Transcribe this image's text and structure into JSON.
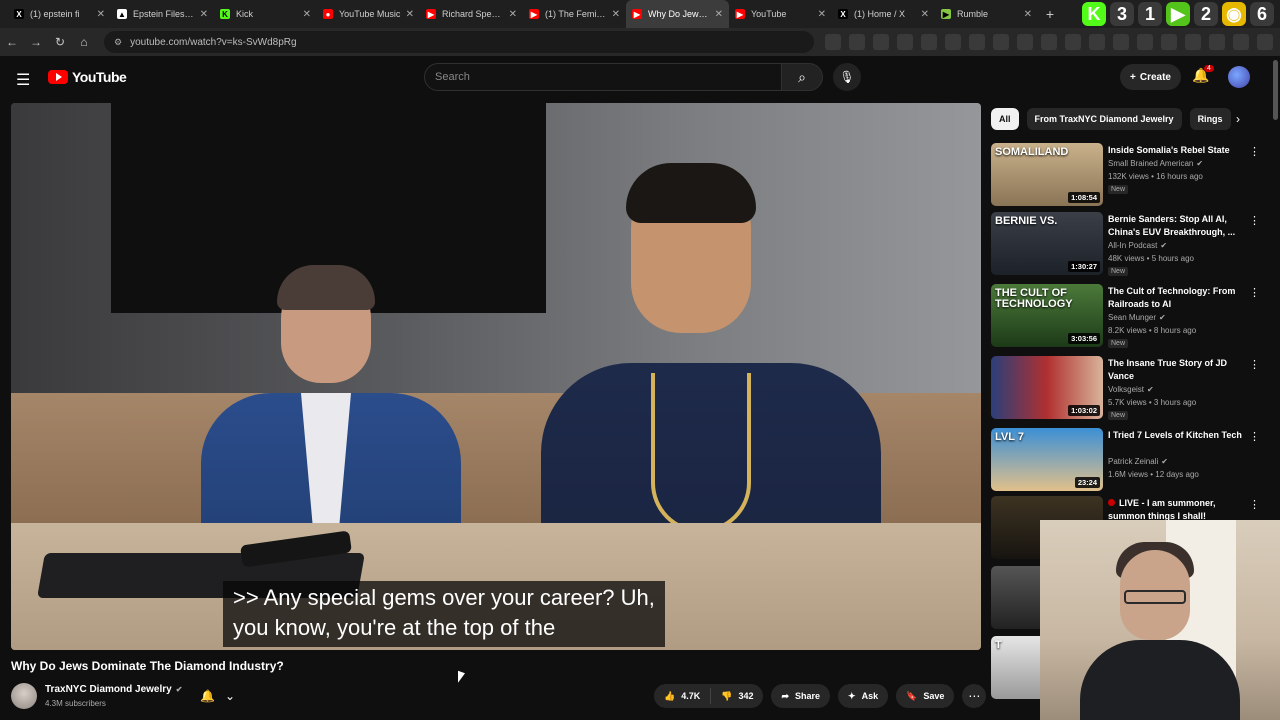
{
  "browser": {
    "tabs": [
      {
        "title": "(1) epstein fi",
        "fav_color": "#000000",
        "fav_glyph": "X"
      },
      {
        "title": "Epstein Files Bro",
        "fav_color": "#ffffff",
        "fav_glyph": "▲"
      },
      {
        "title": "Kick",
        "fav_color": "#53fc18",
        "fav_glyph": "K"
      },
      {
        "title": "YouTube Music",
        "fav_color": "#ff0000",
        "fav_glyph": "●"
      },
      {
        "title": "Richard Spencer",
        "fav_color": "#ff0000",
        "fav_glyph": "▶"
      },
      {
        "title": "(1) The Feminist",
        "fav_color": "#ff0000",
        "fav_glyph": "▶"
      },
      {
        "title": "Why Do Jews D",
        "fav_color": "#ff0000",
        "fav_glyph": "▶",
        "active": true
      },
      {
        "title": "YouTube",
        "fav_color": "#ff0000",
        "fav_glyph": "▶"
      },
      {
        "title": "(1) Home / X",
        "fav_color": "#000000",
        "fav_glyph": "X"
      },
      {
        "title": "Rumble",
        "fav_color": "#85c742",
        "fav_glyph": "▶"
      }
    ],
    "new_tab_glyph": "+",
    "ext_badges": [
      {
        "label": "K",
        "color": "#53fc18"
      },
      {
        "label": "3",
        "color": "#3a3a3a"
      },
      {
        "label": "1",
        "color": "#3a3a3a"
      },
      {
        "label": "▶",
        "color": "#53c41a"
      },
      {
        "label": "2",
        "color": "#3a3a3a"
      },
      {
        "label": "◉",
        "color": "#e6b800"
      },
      {
        "label": "6",
        "color": "#3a3a3a"
      }
    ],
    "url": "youtube.com/watch?v=ks-SvWd8pRg"
  },
  "youtube": {
    "logo_text": "YouTube",
    "search_placeholder": "Search",
    "create_label": "Create",
    "notification_count": "4"
  },
  "video": {
    "caption_line1": ">> Any special gems over your career? Uh,",
    "caption_line2": "you know, you're at the top of the",
    "title": "Why Do Jews Dominate The Diamond Industry?",
    "channel": "TraxNYC Diamond Jewelry",
    "subscribers": "4.3M subscribers",
    "likes": "4.7K",
    "dislikes": "342",
    "share_label": "Share",
    "ask_label": "Ask",
    "save_label": "Save"
  },
  "sidebar": {
    "chips": [
      "All",
      "From TraxNYC Diamond Jewelry",
      "Rings"
    ],
    "recommendations": [
      {
        "title": "Inside Somalia's Rebel State",
        "channel": "Small Brained American",
        "meta": "132K views • 16 hours ago",
        "badge": "New",
        "duration": "1:08:54",
        "thumb_text": "SOMALILAND",
        "thumb_bg": "linear-gradient(180deg,#c9b18a,#8a7456)"
      },
      {
        "title": "Bernie Sanders: Stop All AI, China's EUV Breakthrough, ...",
        "channel": "All-In Podcast",
        "meta": "48K views • 5 hours ago",
        "badge": "New",
        "duration": "1:30:27",
        "thumb_text": "BERNIE VS.",
        "thumb_bg": "linear-gradient(180deg,#3a3f48,#1d2128)"
      },
      {
        "title": "The Cult of Technology: From Railroads to AI",
        "channel": "Sean Munger",
        "meta": "8.2K views • 8 hours ago",
        "badge": "New",
        "duration": "3:03:56",
        "thumb_text": "THE CULT OF TECHNOLOGY",
        "thumb_bg": "linear-gradient(180deg,#4b7a3a,#1d3a18)"
      },
      {
        "title": "The Insane True Story of JD Vance",
        "channel": "Volksgeist",
        "meta": "5.7K views • 3 hours ago",
        "badge": "New",
        "duration": "1:03:02",
        "thumb_text": "",
        "thumb_bg": "linear-gradient(90deg,#2b3f7a 0%,#b03030 50%,#d8b49a 100%)"
      },
      {
        "title": "I Tried 7 Levels of Kitchen Tech",
        "channel": "Patrick Zeinali",
        "meta": "1.6M views • 12 days ago",
        "badge": "",
        "duration": "23:24",
        "thumb_text": "LVL 7",
        "thumb_bg": "linear-gradient(180deg,#3b8fd6,#e2c08a)"
      },
      {
        "title": "LIVE - I am summoner, summon things I shall!",
        "channel": "",
        "meta": "",
        "badge": "",
        "duration": "",
        "thumb_text": "",
        "thumb_bg": "linear-gradient(180deg,#3d3322,#171410)",
        "live": true
      },
      {
        "title": "",
        "channel": "",
        "meta": "",
        "badge": "",
        "duration": "",
        "thumb_text": "",
        "thumb_bg": "linear-gradient(180deg,#555,#222)"
      },
      {
        "title": "",
        "channel": "",
        "meta": "",
        "badge": "",
        "duration": "",
        "thumb_text": "T",
        "thumb_bg": "linear-gradient(180deg,#e6e6e6,#999)"
      }
    ]
  }
}
